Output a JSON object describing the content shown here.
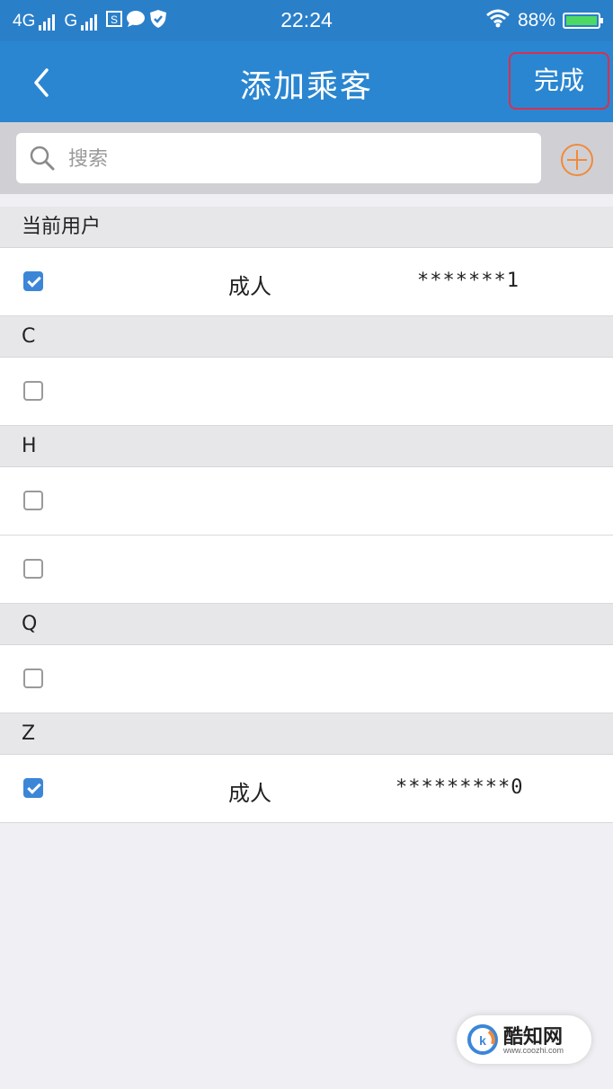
{
  "status_bar": {
    "network1": "4G",
    "network2": "G",
    "time": "22:24",
    "battery": "88%",
    "icons": [
      "signal-icon",
      "s-icon",
      "chat-icon",
      "shield-icon",
      "wifi-icon",
      "battery-icon"
    ]
  },
  "nav": {
    "title": "添加乘客",
    "done_label": "完成",
    "back_icon": "back-chevron-icon"
  },
  "search": {
    "placeholder": "搜索",
    "add_icon": "add-circle-icon"
  },
  "sections": [
    {
      "header": "当前用户",
      "rows": [
        {
          "checked": true,
          "type": "成人",
          "id": "*******1"
        }
      ]
    },
    {
      "header": "C",
      "rows": [
        {
          "checked": false,
          "type": "",
          "id": ""
        }
      ]
    },
    {
      "header": "H",
      "rows": [
        {
          "checked": false,
          "type": "",
          "id": ""
        },
        {
          "checked": false,
          "type": "",
          "id": ""
        }
      ]
    },
    {
      "header": "Q",
      "rows": [
        {
          "checked": false,
          "type": "",
          "id": ""
        }
      ]
    },
    {
      "header": "Z",
      "rows": [
        {
          "checked": true,
          "type": "成人",
          "id": "*********0"
        }
      ]
    }
  ],
  "watermark": {
    "text": "酷知网",
    "url": "www.coozhi.com"
  },
  "colors": {
    "nav_bg": "#2a86d1",
    "highlight_border": "#d9304f",
    "add_icon": "#f08a3c",
    "checkbox_checked": "#3c86d8"
  }
}
